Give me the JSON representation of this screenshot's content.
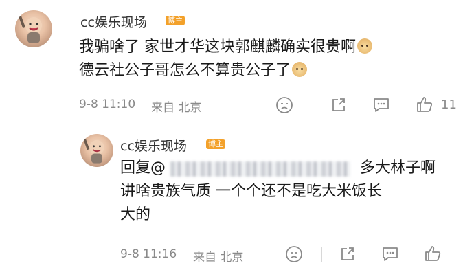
{
  "comment": {
    "username": "cc娱乐现场",
    "badge": "博主",
    "line1": "我骗啥了 家世才华这块郭麒麟确实很贵啊",
    "line2": "德云社公子哥怎么不算贵公子了",
    "timestamp": "9-8 11:10",
    "location": "来自 北京",
    "like_count": "11"
  },
  "reply": {
    "username": "cc娱乐现场",
    "badge": "博主",
    "prefix": "回复@",
    "suffix": "多大林子啊",
    "line2": "讲啥贵族气质 一个个还不是吃大米饭长",
    "line3": "大的",
    "timestamp": "9-8 11:16",
    "location": "来自 北京"
  },
  "icons": [
    "avatar",
    "doge-emoji",
    "dislike-icon",
    "share-icon",
    "comment-icon",
    "like-icon"
  ]
}
